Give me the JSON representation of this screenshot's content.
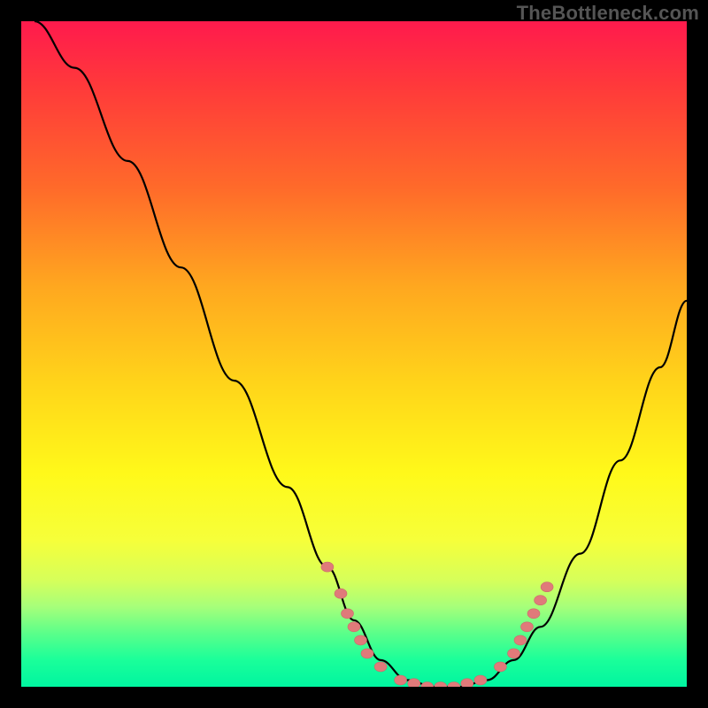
{
  "watermark": "TheBottleneck.com",
  "colors": {
    "dot": "#e07a7a",
    "curve": "#000000"
  },
  "chart_data": {
    "type": "line",
    "title": "",
    "xlabel": "",
    "ylabel": "",
    "xlim": [
      0,
      100
    ],
    "ylim": [
      0,
      100
    ],
    "grid": false,
    "legend": false,
    "curve": [
      {
        "x": 2,
        "y": 100
      },
      {
        "x": 8,
        "y": 93
      },
      {
        "x": 16,
        "y": 79
      },
      {
        "x": 24,
        "y": 63
      },
      {
        "x": 32,
        "y": 46
      },
      {
        "x": 40,
        "y": 30
      },
      {
        "x": 46,
        "y": 18
      },
      {
        "x": 50,
        "y": 10
      },
      {
        "x": 54,
        "y": 4
      },
      {
        "x": 58,
        "y": 1
      },
      {
        "x": 62,
        "y": 0
      },
      {
        "x": 66,
        "y": 0
      },
      {
        "x": 70,
        "y": 1
      },
      {
        "x": 74,
        "y": 4
      },
      {
        "x": 78,
        "y": 9
      },
      {
        "x": 84,
        "y": 20
      },
      {
        "x": 90,
        "y": 34
      },
      {
        "x": 96,
        "y": 48
      },
      {
        "x": 100,
        "y": 58
      }
    ],
    "series": [
      {
        "name": "markers-left",
        "points": [
          {
            "x": 46,
            "y": 18
          },
          {
            "x": 48,
            "y": 14
          },
          {
            "x": 49,
            "y": 11
          },
          {
            "x": 50,
            "y": 9
          },
          {
            "x": 51,
            "y": 7
          },
          {
            "x": 52,
            "y": 5
          },
          {
            "x": 54,
            "y": 3
          }
        ]
      },
      {
        "name": "markers-bottom",
        "points": [
          {
            "x": 57,
            "y": 1
          },
          {
            "x": 59,
            "y": 0.5
          },
          {
            "x": 61,
            "y": 0
          },
          {
            "x": 63,
            "y": 0
          },
          {
            "x": 65,
            "y": 0
          },
          {
            "x": 67,
            "y": 0.5
          },
          {
            "x": 69,
            "y": 1
          }
        ]
      },
      {
        "name": "markers-right",
        "points": [
          {
            "x": 72,
            "y": 3
          },
          {
            "x": 74,
            "y": 5
          },
          {
            "x": 75,
            "y": 7
          },
          {
            "x": 76,
            "y": 9
          },
          {
            "x": 77,
            "y": 11
          },
          {
            "x": 78,
            "y": 13
          },
          {
            "x": 79,
            "y": 15
          }
        ]
      }
    ]
  }
}
